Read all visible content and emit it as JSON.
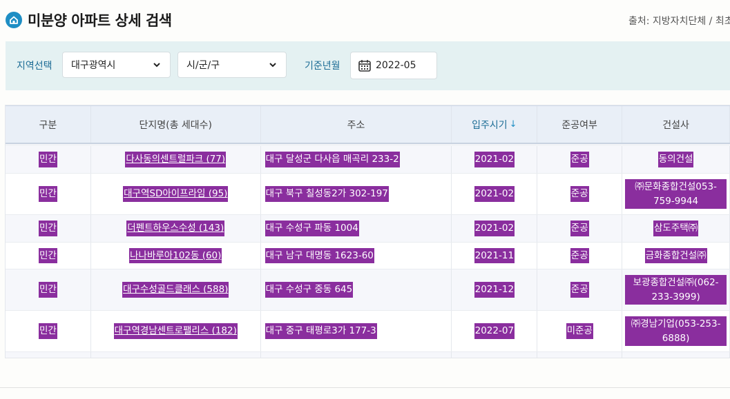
{
  "header": {
    "title": "미분양 아파트 상세 검색",
    "source": "출처: 지방자치단체 / 최초"
  },
  "filter": {
    "region_label": "지역선택",
    "region_value": "대구광역시",
    "district_value": "시/군/구",
    "date_label": "기준년월",
    "date_value": "2022-05"
  },
  "table": {
    "columns": [
      "구분",
      "단지명(총 세대수)",
      "주소",
      "입주시기",
      "준공여부",
      "건설사"
    ],
    "sort_indicator": "↓",
    "rows": [
      {
        "type": "민간",
        "name": "다사동의센트럴파크 (77)",
        "address": "대구 달성군 다사읍 매곡리 233-2",
        "move_in": "2021-02",
        "status": "준공",
        "builder": "동의건설"
      },
      {
        "type": "민간",
        "name": "대구역SD아이프라임 (95)",
        "address": "대구 북구 칠성동2가 302-197",
        "move_in": "2021-02",
        "status": "준공",
        "builder": "㈜문화종합건설053-759-9944"
      },
      {
        "type": "민간",
        "name": "더펜트하우스수성 (143)",
        "address": "대구 수성구 파동 1004",
        "move_in": "2021-02",
        "status": "준공",
        "builder": "삼도주택㈜"
      },
      {
        "type": "민간",
        "name": "나나바루아102동 (60)",
        "address": "대구 남구 대명동 1623-60",
        "move_in": "2021-11",
        "status": "준공",
        "builder": "금화종합건설㈜"
      },
      {
        "type": "민간",
        "name": "대구수성골드클래스 (588)",
        "address": "대구 수성구 중동 645",
        "move_in": "2021-12",
        "status": "준공",
        "builder": "보광종합건설㈜(062-233-3999)"
      },
      {
        "type": "민간",
        "name": "대구역경남센트로팰리스 (182)",
        "address": "대구 중구 태평로3가 177-3",
        "move_in": "2022-07",
        "status": "미준공",
        "builder": "㈜경남기업(053-253-6888)"
      }
    ]
  },
  "colors": {
    "highlight": "#8a2e9e",
    "accent": "#1e8ec4",
    "filter_bg": "#e4f1f2"
  },
  "icons": {
    "logo": "home-icon",
    "dropdown": "chevron-down-icon",
    "calendar": "calendar-icon",
    "sort": "sort-down-arrow-icon"
  }
}
